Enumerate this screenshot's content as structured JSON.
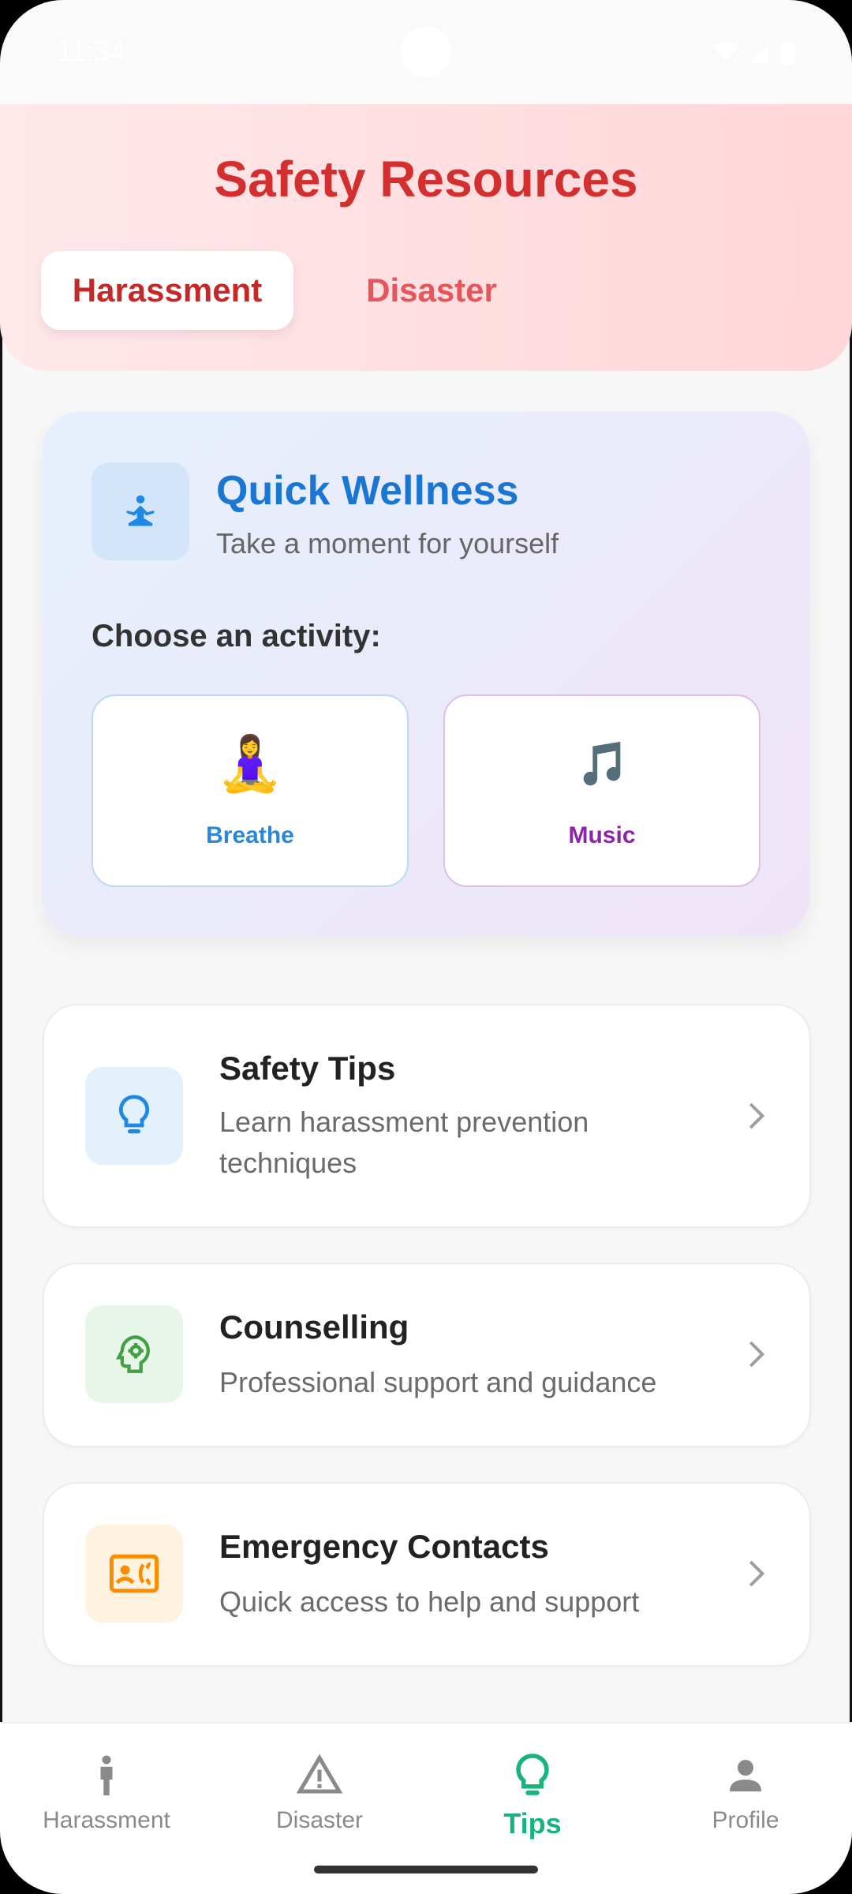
{
  "status_bar": {
    "time": "11:34"
  },
  "header": {
    "title": "Safety Resources",
    "tabs": [
      {
        "label": "Harassment",
        "active": true
      },
      {
        "label": "Disaster",
        "active": false
      }
    ]
  },
  "wellness": {
    "icon": "meditation-icon",
    "title": "Quick Wellness",
    "subtitle": "Take a moment for yourself",
    "prompt": "Choose an activity:",
    "activities": [
      {
        "label": "Breathe",
        "emoji": "🧘‍♀️",
        "color": "#2a86db"
      },
      {
        "label": "Music",
        "emoji": "🎵",
        "color": "#8e24aa"
      }
    ]
  },
  "resources": [
    {
      "icon": "lightbulb-icon",
      "title": "Safety Tips",
      "subtitle": "Learn harassment prevention techniques",
      "accent": "#1e88e5"
    },
    {
      "icon": "psychology-icon",
      "title": "Counselling",
      "subtitle": "Professional support and guidance",
      "accent": "#43a047"
    },
    {
      "icon": "contact-card-icon",
      "title": "Emergency Contacts",
      "subtitle": "Quick access to help and support",
      "accent": "#fb8c00"
    }
  ],
  "bottom_nav": {
    "items": [
      {
        "label": "Harassment",
        "icon": "person-standing-icon",
        "active": false
      },
      {
        "label": "Disaster",
        "icon": "warning-icon",
        "active": false
      },
      {
        "label": "Tips",
        "icon": "lightbulb-icon",
        "active": true
      },
      {
        "label": "Profile",
        "icon": "person-icon",
        "active": false
      }
    ],
    "active_color": "#17b57b"
  }
}
